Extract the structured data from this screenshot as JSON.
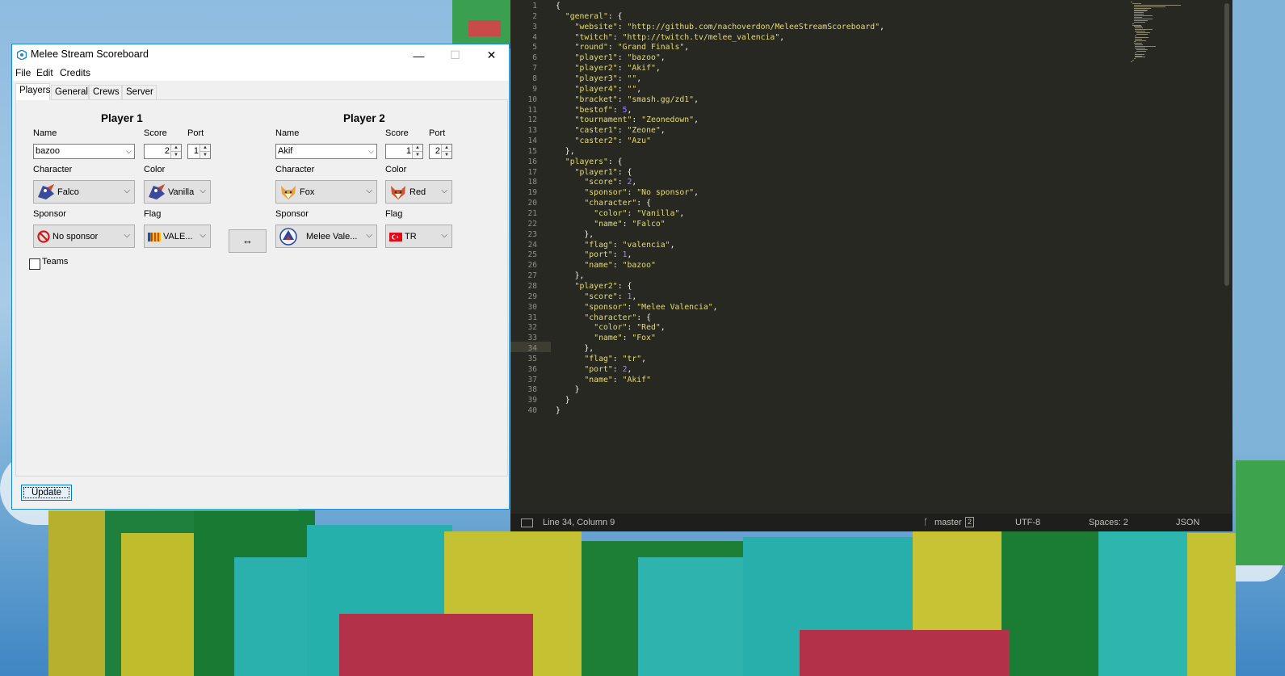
{
  "window": {
    "title": "Melee Stream Scoreboard",
    "minimize": "—",
    "maximize": "☐",
    "close": "✕"
  },
  "menu": [
    "File",
    "Edit",
    "Credits"
  ],
  "tabs": [
    "Players",
    "General",
    "Crews",
    "Server"
  ],
  "labels": {
    "name": "Name",
    "score": "Score",
    "port": "Port",
    "character": "Character",
    "color": "Color",
    "sponsor": "Sponsor",
    "flag": "Flag"
  },
  "player1": {
    "heading": "Player 1",
    "name": "bazoo",
    "score": "2",
    "port": "1",
    "character": "Falco",
    "color": "Vanilla",
    "sponsor": "No sponsor",
    "flag": "VALE..."
  },
  "player2": {
    "heading": "Player 2",
    "name": "Akif",
    "score": "1",
    "port": "2",
    "character": "Fox",
    "color": "Red",
    "sponsor": "Melee Vale...",
    "flag": "TR"
  },
  "swap_label": "↔",
  "teams_label": "Teams",
  "update_label": "Update",
  "editor": {
    "lines": [
      "{",
      "  \"general\": {",
      "    \"website\": \"http://github.com/nachoverdon/MeleeStreamScoreboard\",",
      "    \"twitch\": \"http://twitch.tv/melee_valencia\",",
      "    \"round\": \"Grand Finals\",",
      "    \"player1\": \"bazoo\",",
      "    \"player2\": \"Akif\",",
      "    \"player3\": \"\",",
      "    \"player4\": \"\",",
      "    \"bracket\": \"smash.gg/zd1\",",
      "    \"bestof\": 5,",
      "    \"tournament\": \"Zeonedown\",",
      "    \"caster1\": \"Zeone\",",
      "    \"caster2\": \"Azu\"",
      "  },",
      "  \"players\": {",
      "    \"player1\": {",
      "      \"score\": 2,",
      "      \"sponsor\": \"No sponsor\",",
      "      \"character\": {",
      "        \"color\": \"Vanilla\",",
      "        \"name\": \"Falco\"",
      "      },",
      "      \"flag\": \"valencia\",",
      "      \"port\": 1,",
      "      \"name\": \"bazoo\"",
      "    },",
      "    \"player2\": {",
      "      \"score\": 1,",
      "      \"sponsor\": \"Melee Valencia\",",
      "      \"character\": {",
      "        \"color\": \"Red\",",
      "        \"name\": \"Fox\"",
      "      },",
      "      \"flag\": \"tr\",",
      "      \"port\": 2,",
      "      \"name\": \"Akif\"",
      "    }",
      "  }",
      "}"
    ],
    "status": {
      "position": "Line 34, Column 9",
      "branch": "master",
      "branch_count": "2",
      "encoding": "UTF-8",
      "indent": "Spaces: 2",
      "syntax": "JSON"
    }
  },
  "colors": {
    "editor_bg": "#272822",
    "string": "#e6db74",
    "number": "#ae81ff",
    "window_border": "#1d8ad6"
  }
}
